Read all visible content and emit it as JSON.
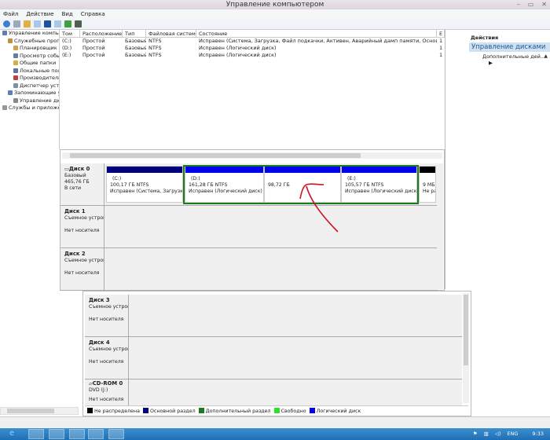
{
  "window": {
    "title": "Управление компьютером",
    "controls": [
      "–",
      "▭",
      "✕"
    ]
  },
  "menu": [
    "Файл",
    "Действие",
    "Вид",
    "Справка"
  ],
  "tree": [
    {
      "label": "Управление компьютером",
      "level": 0,
      "icon": "computer-icon",
      "color": "#5a7fb0"
    },
    {
      "label": "Служебные программы",
      "level": 1,
      "icon": "tools-icon",
      "color": "#c09040"
    },
    {
      "label": "Планировщик заданий",
      "level": 2,
      "icon": "clock-icon",
      "color": "#d0a050"
    },
    {
      "label": "Просмотр событий",
      "level": 2,
      "icon": "event-viewer-icon",
      "color": "#6080a0"
    },
    {
      "label": "Общие папки",
      "level": 2,
      "icon": "folder-icon",
      "color": "#d8b040"
    },
    {
      "label": "Локальные пользователи",
      "level": 2,
      "icon": "users-icon",
      "color": "#6070a0"
    },
    {
      "label": "Производительность",
      "level": 2,
      "icon": "performance-icon",
      "color": "#c04040"
    },
    {
      "label": "Диспетчер устройств",
      "level": 2,
      "icon": "device-manager-icon",
      "color": "#8090a0"
    },
    {
      "label": "Запоминающие устройства",
      "level": 1,
      "icon": "storage-icon",
      "color": "#6080b0"
    },
    {
      "label": "Управление дисками",
      "level": 2,
      "icon": "disk-management-icon",
      "color": "#808890"
    },
    {
      "label": "Службы и приложения",
      "level": 0,
      "icon": "services-icon",
      "color": "#9098a0"
    }
  ],
  "table": {
    "headers": [
      "Том",
      "Расположение",
      "Тип",
      "Файловая система",
      "Состояние",
      "Е"
    ],
    "rows": [
      [
        "(C:)",
        "Простой",
        "Базовый",
        "NTFS",
        "Исправен (Система, Загрузка, Файл подкачки, Активен, Аварийный дамп памяти, Основной раздел)",
        "1"
      ],
      [
        "(D:)",
        "Простой",
        "Базовый",
        "NTFS",
        "Исправен (Логический диск)",
        "1"
      ],
      [
        "(E:)",
        "Простой",
        "Базовый",
        "NTFS",
        "Исправен (Логический диск)",
        "1"
      ]
    ]
  },
  "actions": {
    "header": "Действия",
    "selected": "Управление дисками",
    "sub": "Дополнительные дей..."
  },
  "disks": [
    {
      "name": "Диск 0",
      "type": "Базовый",
      "size": "465,76 ГБ",
      "status": "В сети"
    },
    {
      "name": "Диск 1",
      "type": "Съемное устройство",
      "status": "Нет носителя"
    },
    {
      "name": "Диск 2",
      "type": "Съемное устройство",
      "status": "Нет носителя"
    },
    {
      "name": "Диск 3",
      "type": "Съемное устройство",
      "status": "Нет носителя"
    },
    {
      "name": "Диск 4",
      "type": "Съемное устройство",
      "status": "Нет носителя"
    },
    {
      "name": "CD-ROM 0",
      "type": "DVD (J:)",
      "status": "Нет носителя"
    }
  ],
  "partitions": [
    {
      "label": "(C:)",
      "size": "100,17 ГБ NTFS",
      "status": "Исправен (Система, Загрузка,",
      "color": "#00007a"
    },
    {
      "label": "(D:)",
      "size": "161,28 ГБ NTFS",
      "status": "Исправен (Логический диск)",
      "color": "#0000f0"
    },
    {
      "label": "",
      "size": "98,72 ГБ",
      "status": "",
      "color": "#0000f0"
    },
    {
      "label": "(E:)",
      "size": "105,57 ГБ NTFS",
      "status": "Исправен (Логический диск)",
      "color": "#0000f0"
    },
    {
      "label": "",
      "size": "9 МБ",
      "status": "Не распределена",
      "color": "#000000"
    }
  ],
  "legend": [
    {
      "label": "Не распределена",
      "color": "#000000"
    },
    {
      "label": "Основной раздел",
      "color": "#00007a"
    },
    {
      "label": "Дополнительный раздел",
      "color": "#1e7a1e"
    },
    {
      "label": "Свободно",
      "color": "#30e030"
    },
    {
      "label": "Логический диск",
      "color": "#0000f0"
    }
  ],
  "tray": {
    "lang": "ENG",
    "time": "9:33"
  }
}
